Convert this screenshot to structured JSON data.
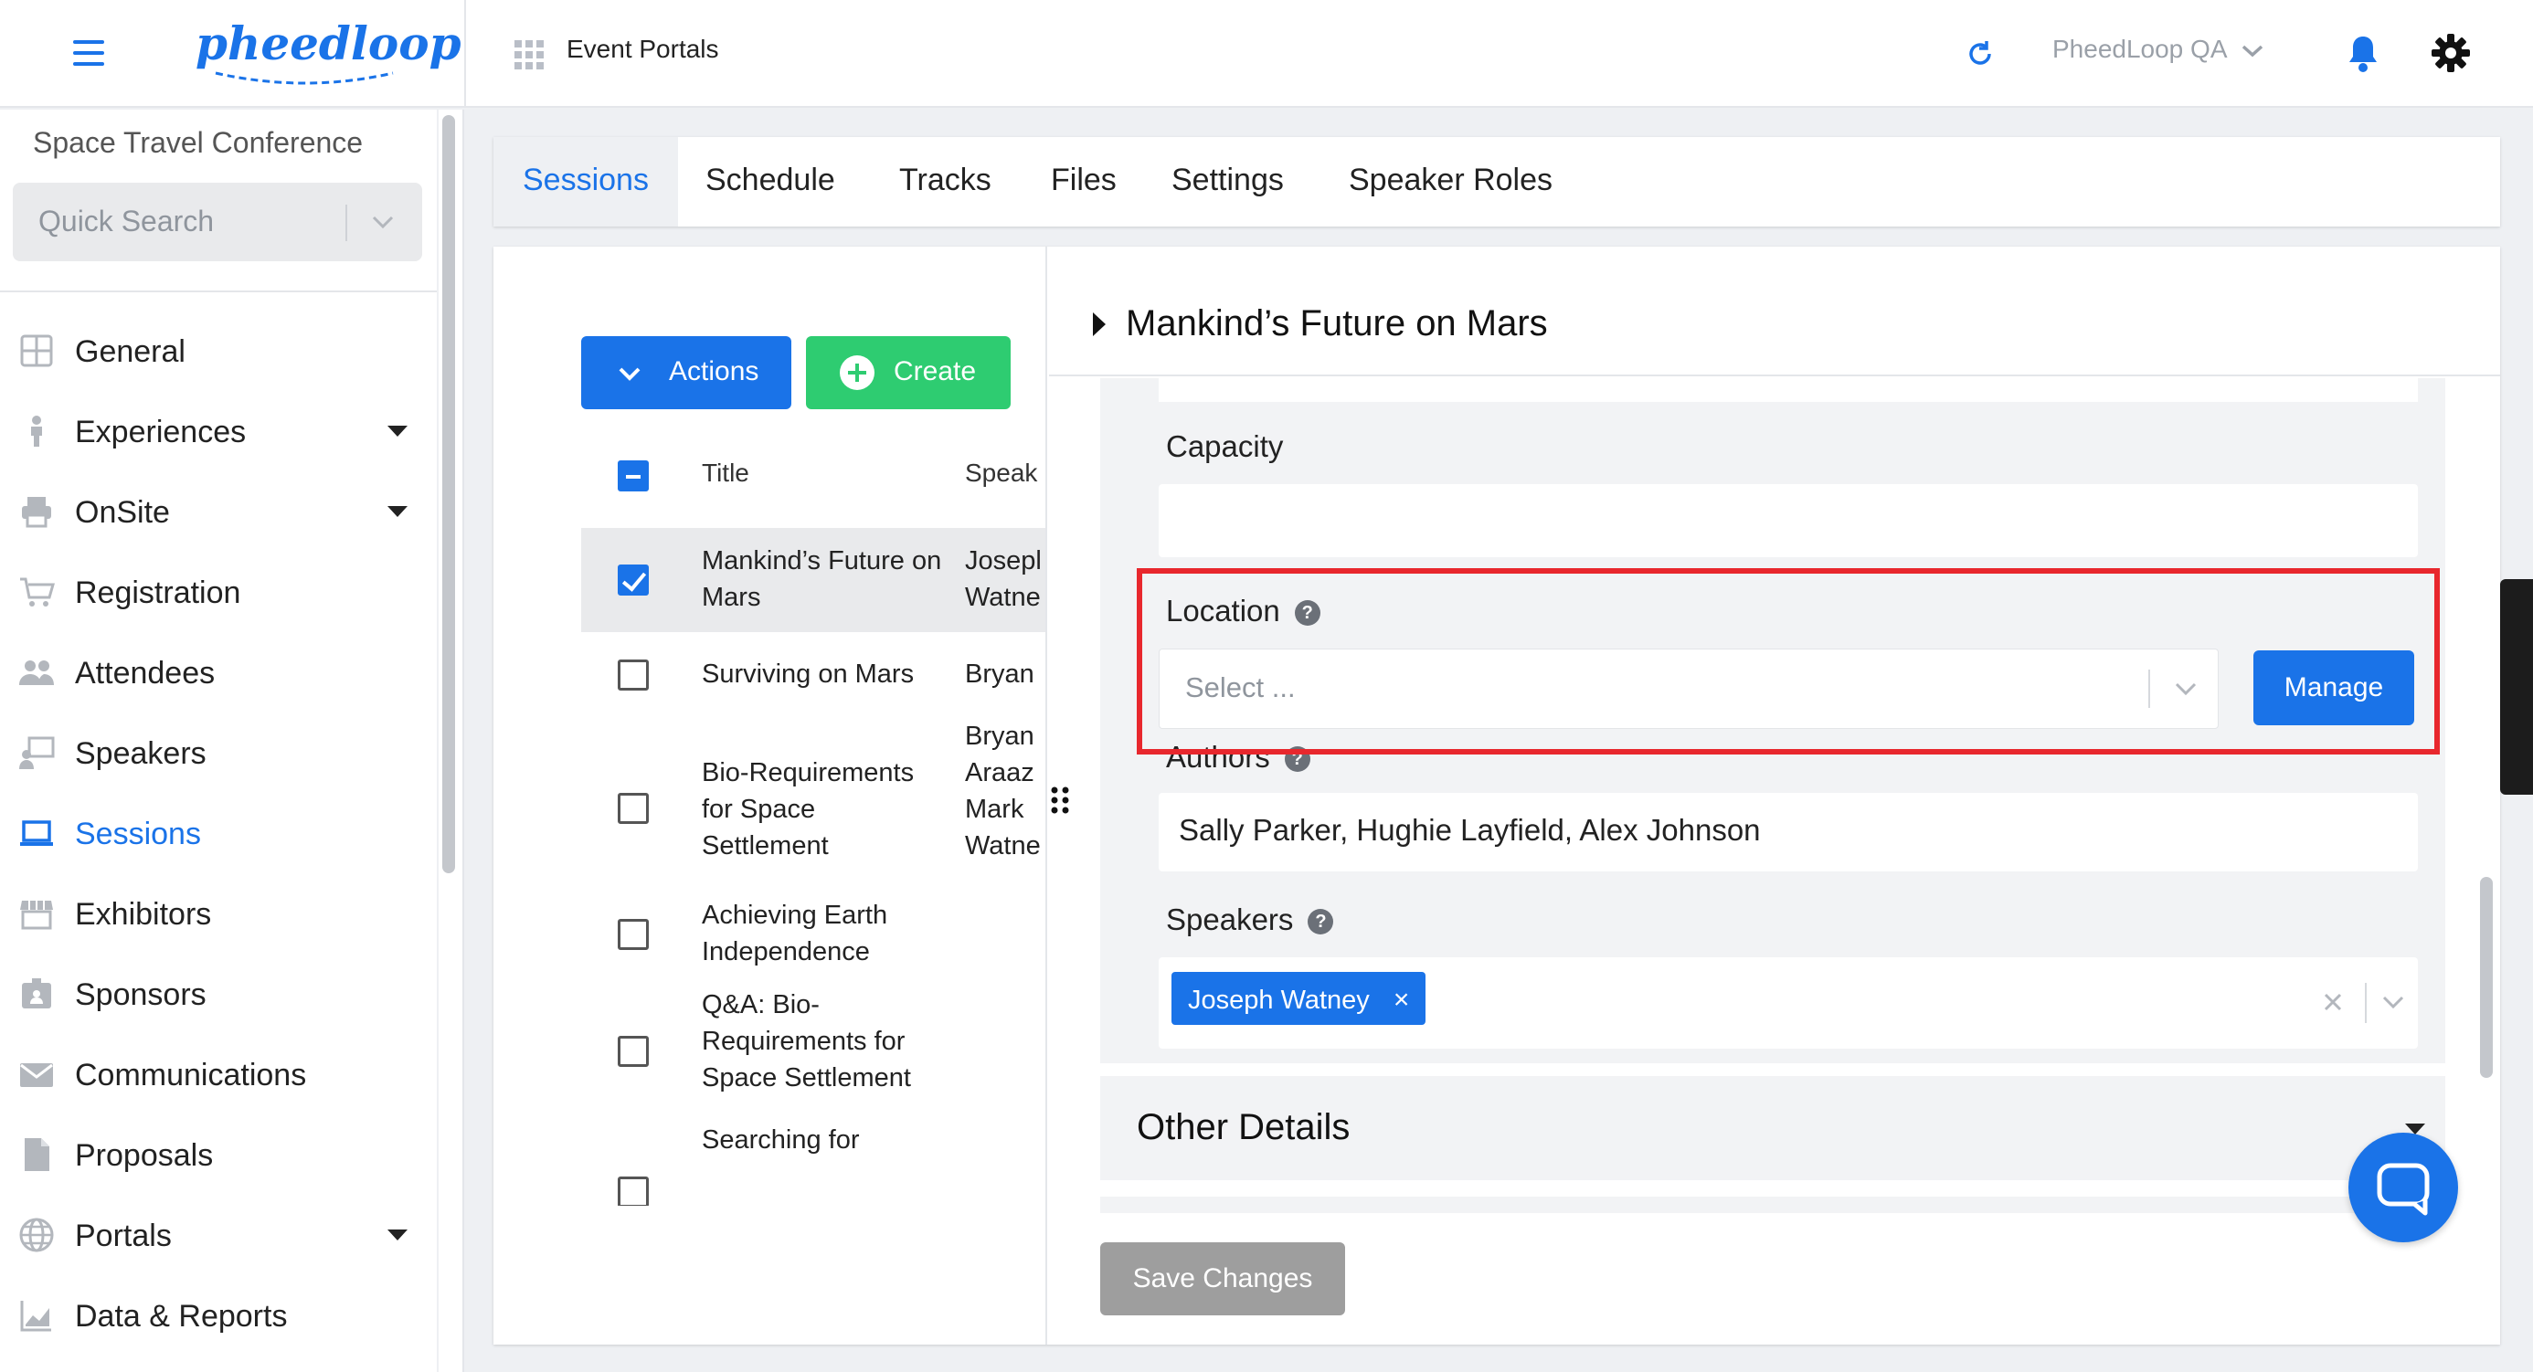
{
  "header": {
    "logo_text": "pheedloop",
    "app_title": "Event Portals",
    "org_selector": "PheedLoop QA",
    "colors": {
      "primary": "#1a73e8",
      "success": "#2ecc71",
      "highlight": "#e8272d"
    }
  },
  "sidebar": {
    "event_name": "Space Travel Conference",
    "quick_search_placeholder": "Quick Search",
    "items": [
      {
        "label": "General",
        "icon": "grid-icon",
        "expandable": false
      },
      {
        "label": "Experiences",
        "icon": "person-icon",
        "expandable": true
      },
      {
        "label": "OnSite",
        "icon": "printer-icon",
        "expandable": true
      },
      {
        "label": "Registration",
        "icon": "cart-icon",
        "expandable": false
      },
      {
        "label": "Attendees",
        "icon": "people-icon",
        "expandable": false
      },
      {
        "label": "Speakers",
        "icon": "presenter-icon",
        "expandable": false
      },
      {
        "label": "Sessions",
        "icon": "laptop-icon",
        "expandable": false,
        "active": true
      },
      {
        "label": "Exhibitors",
        "icon": "storefront-icon",
        "expandable": false
      },
      {
        "label": "Sponsors",
        "icon": "badge-icon",
        "expandable": false
      },
      {
        "label": "Communications",
        "icon": "envelope-icon",
        "expandable": false
      },
      {
        "label": "Proposals",
        "icon": "document-icon",
        "expandable": false
      },
      {
        "label": "Portals",
        "icon": "globe-icon",
        "expandable": true
      },
      {
        "label": "Data & Reports",
        "icon": "chart-icon",
        "expandable": false
      }
    ]
  },
  "tabs": [
    {
      "label": "Sessions",
      "active": true
    },
    {
      "label": "Schedule"
    },
    {
      "label": "Tracks"
    },
    {
      "label": "Files"
    },
    {
      "label": "Settings"
    },
    {
      "label": "Speaker Roles"
    }
  ],
  "list": {
    "actions_label": "Actions",
    "create_label": "Create",
    "columns": {
      "title": "Title",
      "speakers": "Speak"
    },
    "rows": [
      {
        "title": "Mankind’s Future on Mars",
        "speakers": "Josepl\nWatne",
        "checked": true
      },
      {
        "title": "Surviving on Mars",
        "speakers": "Bryan",
        "checked": false
      },
      {
        "title": "Bio-Requirements for Space Settlement",
        "speakers": "Bryan\nAraaz\nMark\nWatne",
        "checked": false
      },
      {
        "title": "Achieving Earth Independence",
        "speakers": "",
        "checked": false
      },
      {
        "title": "Q&A: Bio-Requirements for Space Settlement",
        "speakers": "",
        "checked": false
      },
      {
        "title": "Searching for",
        "speakers": "",
        "checked": false
      }
    ]
  },
  "detail": {
    "title": "Mankind’s Future on Mars",
    "capacity_label": "Capacity",
    "capacity_value": "",
    "location_label": "Location",
    "location_placeholder": "Select ...",
    "manage_label": "Manage",
    "authors_label": "Authors",
    "authors_value": "Sally Parker, Hughie Layfield, Alex Johnson",
    "speakers_label": "Speakers",
    "speakers_chips": [
      "Joseph Watney"
    ],
    "help_glyph": "?",
    "other_details_label": "Other Details",
    "save_label": "Save Changes"
  }
}
